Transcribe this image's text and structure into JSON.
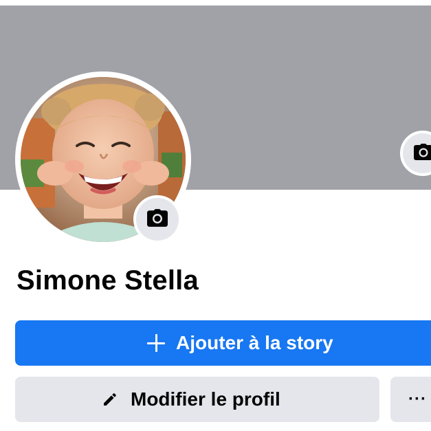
{
  "profile": {
    "name": "Simone Stella"
  },
  "actions": {
    "add_story_label": "Ajouter à la story",
    "edit_profile_label": "Modifier le profil",
    "more_label": "···"
  },
  "icons": {
    "cover_camera": "camera-icon",
    "avatar_camera": "camera-icon",
    "add_story": "plus-icon",
    "edit_profile": "pencil-icon"
  },
  "colors": {
    "cover_background": "#a0a2a7",
    "primary_button": "#1877f2",
    "secondary_button": "#e4e6eb",
    "text": "#050505"
  }
}
